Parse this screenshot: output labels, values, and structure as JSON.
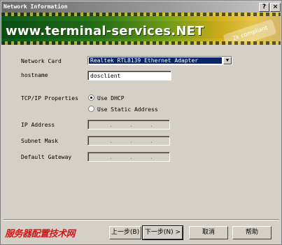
{
  "window": {
    "title": "Network Information",
    "help_label": "?",
    "close_label": "×"
  },
  "banner": {
    "text": "www.terminal-services.NET",
    "badge": "2k compliant"
  },
  "form": {
    "network_card": {
      "label": "Network Card",
      "value": "Realtek RTL8139 Ethernet Adapter"
    },
    "hostname": {
      "label": "hostname",
      "value": "dosclient"
    },
    "tcpip": {
      "label": "TCP/IP Properties",
      "options": [
        {
          "label": "Use DHCP",
          "selected": true
        },
        {
          "label": "Use Static Address",
          "selected": false
        }
      ]
    },
    "ip_address": {
      "label": "IP Address"
    },
    "subnet_mask": {
      "label": "Subnet Mask"
    },
    "default_gateway": {
      "label": "Default Gateway"
    }
  },
  "buttons": {
    "back": "上一步(B)",
    "next": "下一步(N) >",
    "cancel": "取消",
    "help": "帮助"
  },
  "watermark": "服务器配置技术网"
}
